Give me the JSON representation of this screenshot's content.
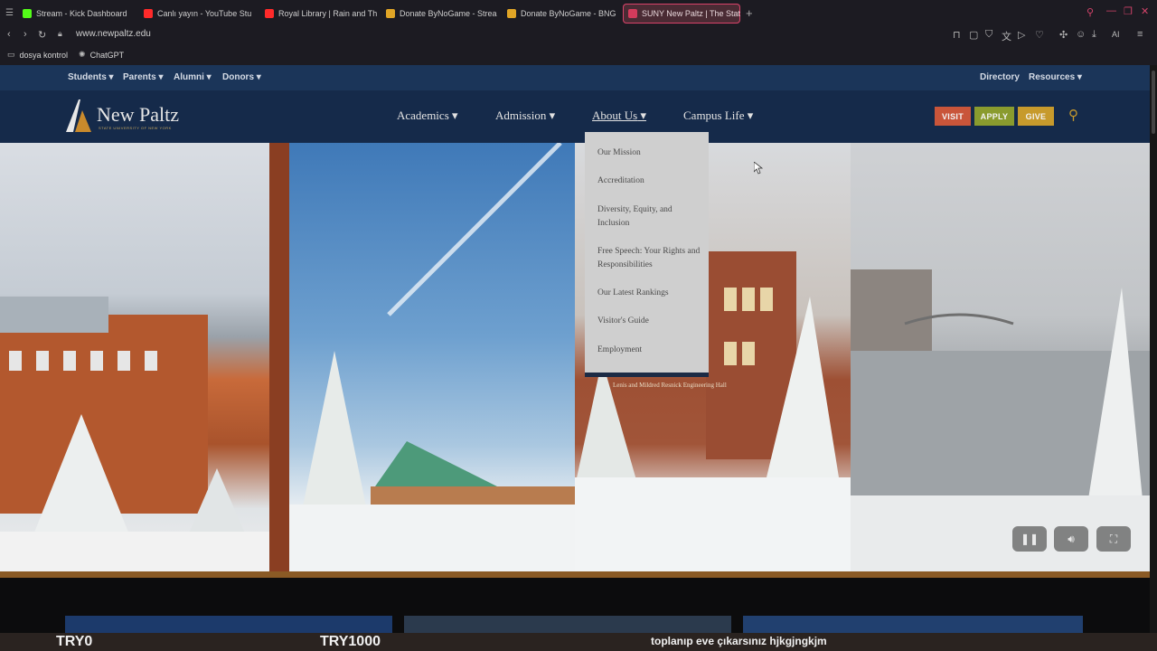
{
  "browser": {
    "tabs": [
      {
        "label": "Stream - Kick Dashboard",
        "color": "#53fc18"
      },
      {
        "label": "Canlı yayın - YouTube Stu",
        "color": "#ff2a2a"
      },
      {
        "label": "Royal Library | Rain and Th",
        "color": "#ff2a2a"
      },
      {
        "label": "Donate ByNoGame - Strea",
        "color": "#e0a526"
      },
      {
        "label": "Donate ByNoGame - BNG",
        "color": "#e0a526"
      },
      {
        "label": "SUNY New Paltz | The Stat",
        "color": "#d43b5c",
        "active": true
      }
    ],
    "new_tab_label": "+",
    "url": "www.newpaltz.edu",
    "bookmarks": [
      {
        "label": "dosya kontrol",
        "icon": "folder-icon"
      },
      {
        "label": "ChatGPT",
        "icon": "chatgpt-icon"
      }
    ],
    "ai_label": "AI"
  },
  "site": {
    "utility_left": [
      "Students",
      "Parents",
      "Alumni",
      "Donors"
    ],
    "utility_right": [
      "Directory",
      "Resources"
    ],
    "logo_text": "New Paltz",
    "logo_sub": "STATE UNIVERSITY OF NEW YORK",
    "nav": [
      "Academics",
      "Admission",
      "About Us",
      "Campus Life"
    ],
    "buttons": [
      {
        "label": "VISIT",
        "color": "#c9553a"
      },
      {
        "label": "APPLY",
        "color": "#8a9b2e"
      },
      {
        "label": "GIVE",
        "color": "#c79a2c"
      }
    ],
    "dropdown": [
      "Our Mission",
      "Accreditation",
      "Diversity, Equity, and Inclusion",
      "Free Speech: Your Rights and Responsibilities",
      "Our Latest Rankings",
      "Visitor's Guide",
      "Employment"
    ],
    "building_sign": "Lenis and Mildred Resnick Engineering Hall"
  },
  "overlay": {
    "left": "TRY0",
    "mid": "TRY1000",
    "right": "toplanıp eve çıkarsınız hjkgjngkjm"
  }
}
